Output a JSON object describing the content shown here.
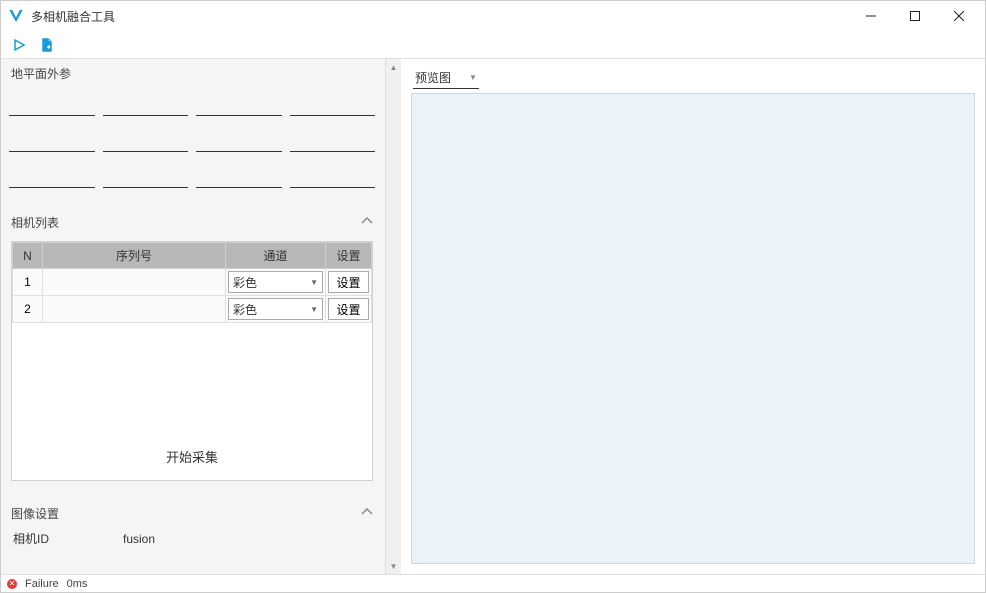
{
  "window": {
    "title": "多相机融合工具"
  },
  "sections": {
    "ground_plane": {
      "title": "地平面外参"
    },
    "camera_list": {
      "title": "相机列表",
      "headers": {
        "n": "N",
        "serial": "序列号",
        "channel": "通道",
        "settings": "设置"
      },
      "rows": [
        {
          "n": "1",
          "serial": "",
          "channel": "彩色",
          "settings": "设置"
        },
        {
          "n": "2",
          "serial": "",
          "channel": "彩色",
          "settings": "设置"
        }
      ],
      "start_capture": "开始采集"
    },
    "image_settings": {
      "title": "图像设置",
      "camera_id_label": "相机ID",
      "camera_id_value": "fusion"
    }
  },
  "preview": {
    "label": "预览图"
  },
  "status": {
    "text": "Failure",
    "time": "0ms"
  }
}
